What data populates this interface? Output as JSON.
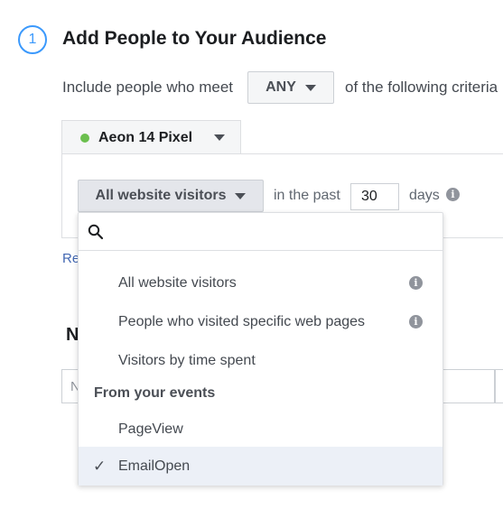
{
  "step": {
    "number": "1",
    "title": "Add People to Your Audience"
  },
  "criteria": {
    "prefix": "Include people who meet",
    "match_value": "ANY",
    "suffix": "of the following criteria"
  },
  "pixel": {
    "name": "Aeon 14 Pixel",
    "status_color": "#6bbf4e"
  },
  "rule": {
    "selected_option": "All website visitors",
    "in_the_past_label": "in the past",
    "days_value": "30",
    "days_label": "days"
  },
  "background": {
    "link_partial": "Re",
    "section_partial": "N",
    "input_placeholder_partial": "N"
  },
  "dropdown": {
    "search_placeholder": "",
    "items": [
      {
        "label": "All website visitors",
        "has_info": true
      },
      {
        "label": "People who visited specific web pages",
        "has_info": true
      },
      {
        "label": "Visitors by time spent",
        "has_info": false
      }
    ],
    "events_header": "From your events",
    "events": [
      {
        "label": "PageView",
        "selected": false
      },
      {
        "label": "EmailOpen",
        "selected": true
      }
    ],
    "check_glyph": "✓"
  },
  "colors": {
    "accent": "#3b99fc",
    "link": "#4267b2",
    "selected_bg": "#ecf0f7"
  }
}
